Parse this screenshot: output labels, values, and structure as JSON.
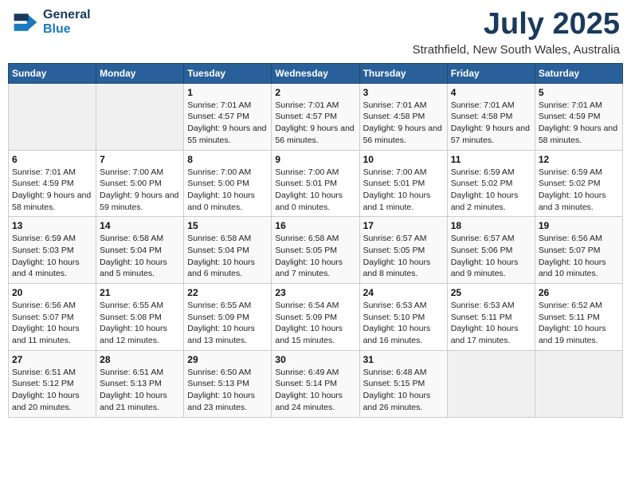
{
  "logo": {
    "line1": "General",
    "line2": "Blue",
    "icon": "▶"
  },
  "title": "July 2025",
  "location": "Strathfield, New South Wales, Australia",
  "days_of_week": [
    "Sunday",
    "Monday",
    "Tuesday",
    "Wednesday",
    "Thursday",
    "Friday",
    "Saturday"
  ],
  "weeks": [
    [
      {
        "day": "",
        "info": ""
      },
      {
        "day": "",
        "info": ""
      },
      {
        "day": "1",
        "info": "Sunrise: 7:01 AM\nSunset: 4:57 PM\nDaylight: 9 hours and 55 minutes."
      },
      {
        "day": "2",
        "info": "Sunrise: 7:01 AM\nSunset: 4:57 PM\nDaylight: 9 hours and 56 minutes."
      },
      {
        "day": "3",
        "info": "Sunrise: 7:01 AM\nSunset: 4:58 PM\nDaylight: 9 hours and 56 minutes."
      },
      {
        "day": "4",
        "info": "Sunrise: 7:01 AM\nSunset: 4:58 PM\nDaylight: 9 hours and 57 minutes."
      },
      {
        "day": "5",
        "info": "Sunrise: 7:01 AM\nSunset: 4:59 PM\nDaylight: 9 hours and 58 minutes."
      }
    ],
    [
      {
        "day": "6",
        "info": "Sunrise: 7:01 AM\nSunset: 4:59 PM\nDaylight: 9 hours and 58 minutes."
      },
      {
        "day": "7",
        "info": "Sunrise: 7:00 AM\nSunset: 5:00 PM\nDaylight: 9 hours and 59 minutes."
      },
      {
        "day": "8",
        "info": "Sunrise: 7:00 AM\nSunset: 5:00 PM\nDaylight: 10 hours and 0 minutes."
      },
      {
        "day": "9",
        "info": "Sunrise: 7:00 AM\nSunset: 5:01 PM\nDaylight: 10 hours and 0 minutes."
      },
      {
        "day": "10",
        "info": "Sunrise: 7:00 AM\nSunset: 5:01 PM\nDaylight: 10 hours and 1 minute."
      },
      {
        "day": "11",
        "info": "Sunrise: 6:59 AM\nSunset: 5:02 PM\nDaylight: 10 hours and 2 minutes."
      },
      {
        "day": "12",
        "info": "Sunrise: 6:59 AM\nSunset: 5:02 PM\nDaylight: 10 hours and 3 minutes."
      }
    ],
    [
      {
        "day": "13",
        "info": "Sunrise: 6:59 AM\nSunset: 5:03 PM\nDaylight: 10 hours and 4 minutes."
      },
      {
        "day": "14",
        "info": "Sunrise: 6:58 AM\nSunset: 5:04 PM\nDaylight: 10 hours and 5 minutes."
      },
      {
        "day": "15",
        "info": "Sunrise: 6:58 AM\nSunset: 5:04 PM\nDaylight: 10 hours and 6 minutes."
      },
      {
        "day": "16",
        "info": "Sunrise: 6:58 AM\nSunset: 5:05 PM\nDaylight: 10 hours and 7 minutes."
      },
      {
        "day": "17",
        "info": "Sunrise: 6:57 AM\nSunset: 5:05 PM\nDaylight: 10 hours and 8 minutes."
      },
      {
        "day": "18",
        "info": "Sunrise: 6:57 AM\nSunset: 5:06 PM\nDaylight: 10 hours and 9 minutes."
      },
      {
        "day": "19",
        "info": "Sunrise: 6:56 AM\nSunset: 5:07 PM\nDaylight: 10 hours and 10 minutes."
      }
    ],
    [
      {
        "day": "20",
        "info": "Sunrise: 6:56 AM\nSunset: 5:07 PM\nDaylight: 10 hours and 11 minutes."
      },
      {
        "day": "21",
        "info": "Sunrise: 6:55 AM\nSunset: 5:08 PM\nDaylight: 10 hours and 12 minutes."
      },
      {
        "day": "22",
        "info": "Sunrise: 6:55 AM\nSunset: 5:09 PM\nDaylight: 10 hours and 13 minutes."
      },
      {
        "day": "23",
        "info": "Sunrise: 6:54 AM\nSunset: 5:09 PM\nDaylight: 10 hours and 15 minutes."
      },
      {
        "day": "24",
        "info": "Sunrise: 6:53 AM\nSunset: 5:10 PM\nDaylight: 10 hours and 16 minutes."
      },
      {
        "day": "25",
        "info": "Sunrise: 6:53 AM\nSunset: 5:11 PM\nDaylight: 10 hours and 17 minutes."
      },
      {
        "day": "26",
        "info": "Sunrise: 6:52 AM\nSunset: 5:11 PM\nDaylight: 10 hours and 19 minutes."
      }
    ],
    [
      {
        "day": "27",
        "info": "Sunrise: 6:51 AM\nSunset: 5:12 PM\nDaylight: 10 hours and 20 minutes."
      },
      {
        "day": "28",
        "info": "Sunrise: 6:51 AM\nSunset: 5:13 PM\nDaylight: 10 hours and 21 minutes."
      },
      {
        "day": "29",
        "info": "Sunrise: 6:50 AM\nSunset: 5:13 PM\nDaylight: 10 hours and 23 minutes."
      },
      {
        "day": "30",
        "info": "Sunrise: 6:49 AM\nSunset: 5:14 PM\nDaylight: 10 hours and 24 minutes."
      },
      {
        "day": "31",
        "info": "Sunrise: 6:48 AM\nSunset: 5:15 PM\nDaylight: 10 hours and 26 minutes."
      },
      {
        "day": "",
        "info": ""
      },
      {
        "day": "",
        "info": ""
      }
    ]
  ]
}
